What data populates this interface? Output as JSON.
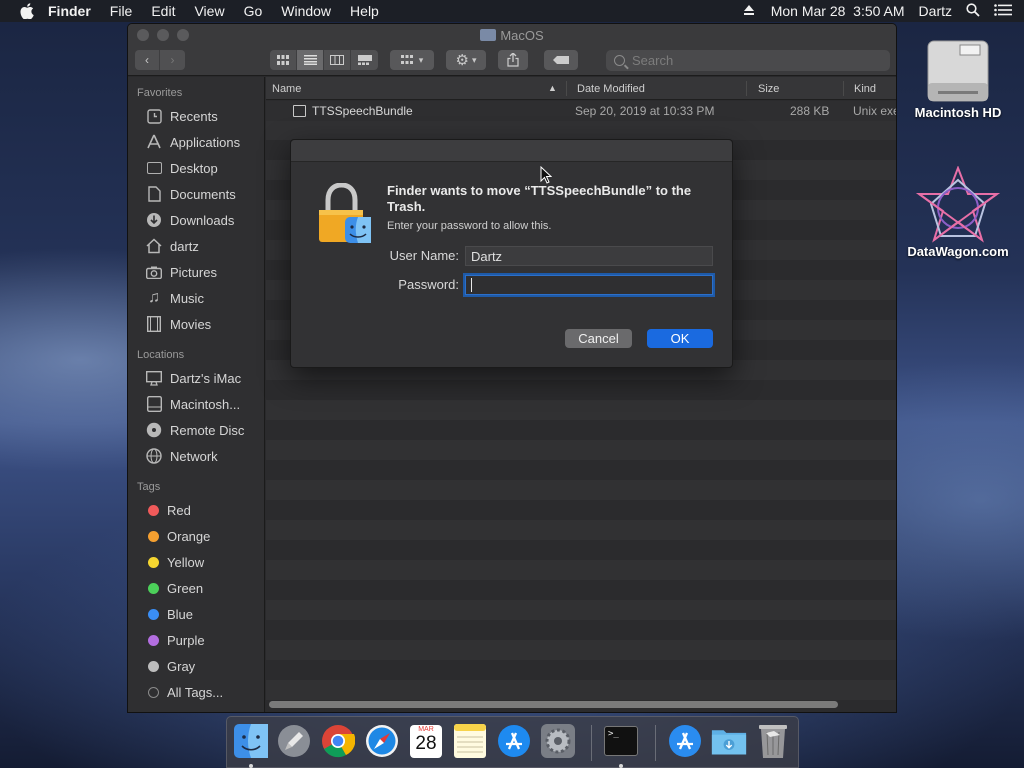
{
  "menubar": {
    "app": "Finder",
    "items": [
      "File",
      "Edit",
      "View",
      "Go",
      "Window",
      "Help"
    ],
    "datetime": "Mon Mar 28  3:50 AM",
    "user": "Dartz"
  },
  "window": {
    "title": "MacOS",
    "search_placeholder": "Search",
    "sidebar": {
      "favorites_label": "Favorites",
      "favorites": [
        "Recents",
        "Applications",
        "Desktop",
        "Documents",
        "Downloads",
        "dartz",
        "Pictures",
        "Music",
        "Movies"
      ],
      "locations_label": "Locations",
      "locations": [
        "Dartz's iMac",
        "Macintosh...",
        "Remote Disc",
        "Network"
      ],
      "tags_label": "Tags",
      "tags": [
        {
          "name": "Red",
          "color": "#f05a5a"
        },
        {
          "name": "Orange",
          "color": "#f5a030"
        },
        {
          "name": "Yellow",
          "color": "#f5d630"
        },
        {
          "name": "Green",
          "color": "#4cd05a"
        },
        {
          "name": "Blue",
          "color": "#3a8ef5"
        },
        {
          "name": "Purple",
          "color": "#b36ee0"
        },
        {
          "name": "Gray",
          "color": "#bdbdbd"
        }
      ],
      "all_tags": "All Tags..."
    },
    "columns": {
      "name": "Name",
      "date": "Date Modified",
      "size": "Size",
      "kind": "Kind"
    },
    "rows": [
      {
        "name": "TTSSpeechBundle",
        "date": "Sep 20, 2019 at 10:33 PM",
        "size": "288 KB",
        "kind": "Unix exe"
      }
    ]
  },
  "dialog": {
    "title": "Finder wants to move “TTSSpeechBundle” to the Trash.",
    "subtitle": "Enter your password to allow this.",
    "username_label": "User Name:",
    "username_value": "Dartz",
    "password_label": "Password:",
    "password_value": "",
    "cancel": "Cancel",
    "ok": "OK"
  },
  "desktop": {
    "hd_label": "Macintosh HD",
    "dw_label": "DataWagon.com"
  },
  "dock": {
    "calendar_month": "MAR",
    "calendar_day": "28",
    "terminal_prompt": ">_"
  },
  "colors": {
    "accent": "#1a6ae0",
    "focus_ring": "#2c6fc9"
  }
}
